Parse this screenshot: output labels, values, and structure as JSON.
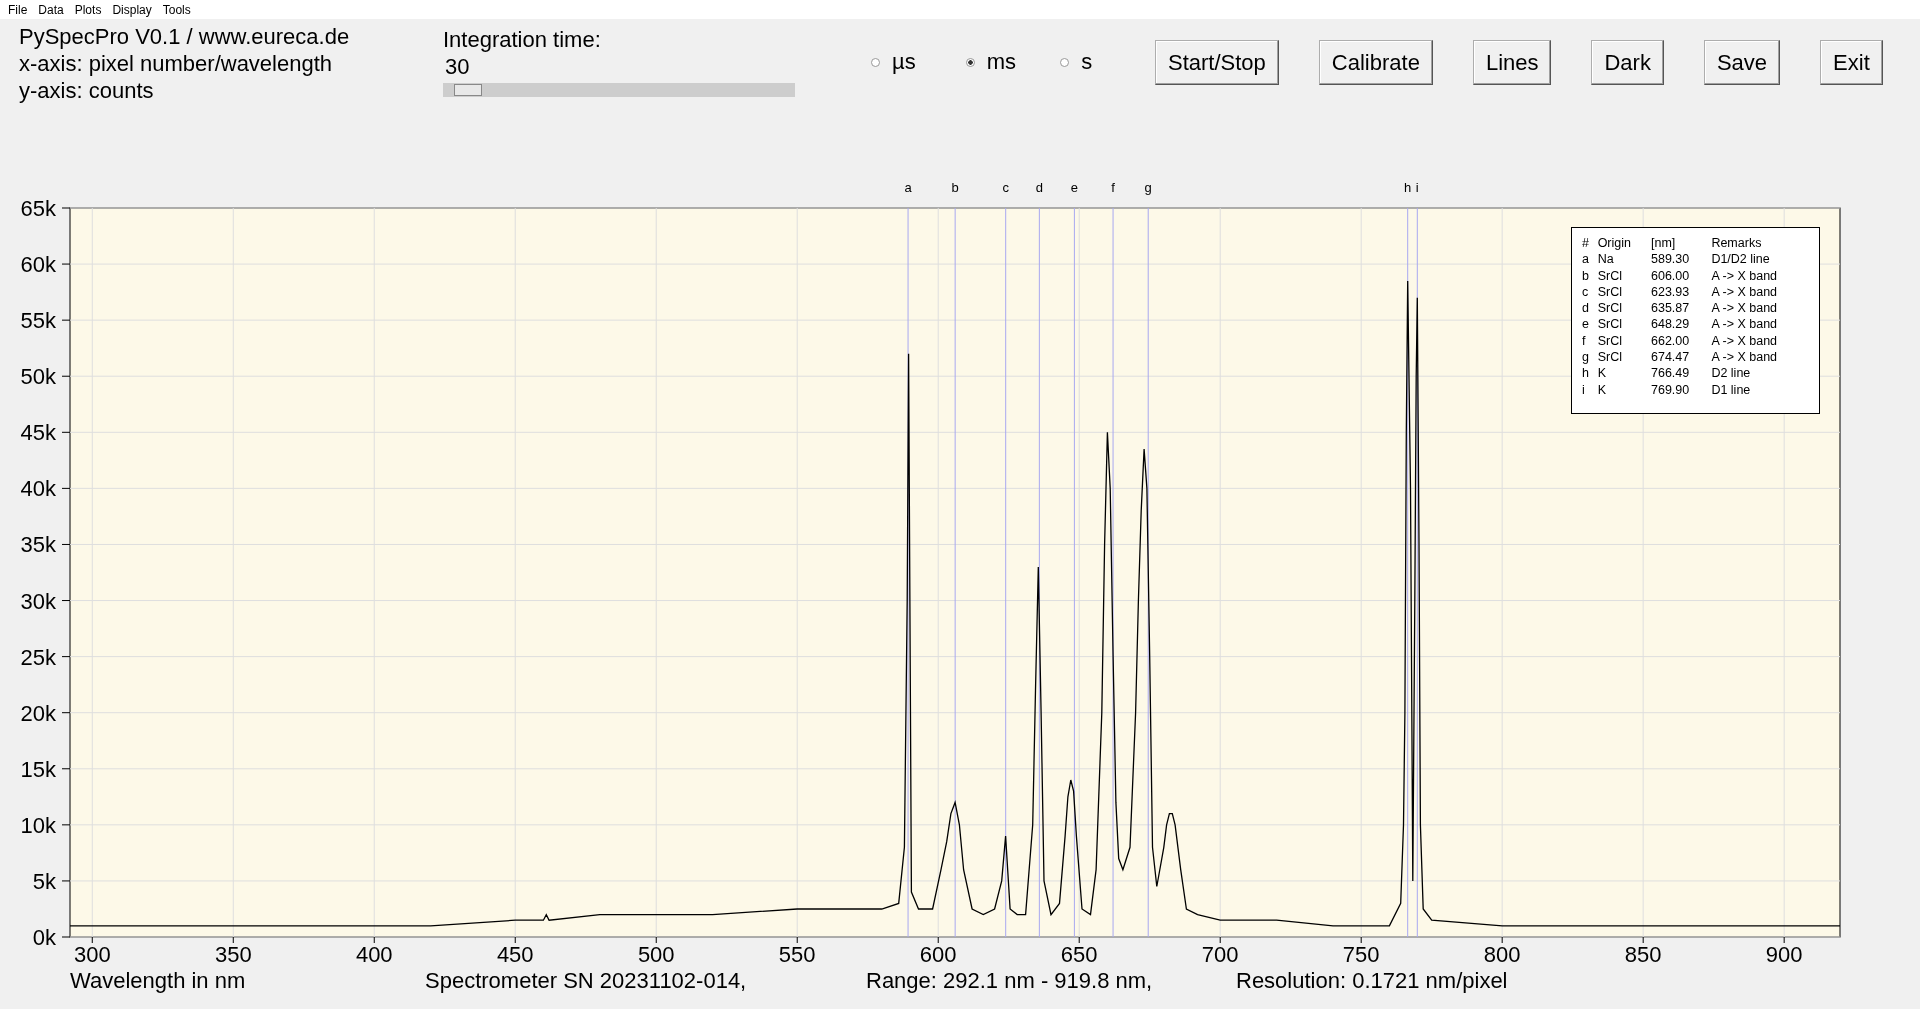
{
  "menu": [
    "File",
    "Data",
    "Plots",
    "Display",
    "Tools"
  ],
  "info": [
    "PySpecPro V0.1 / www.eureca.de",
    "x-axis: pixel number/wavelength",
    "y-axis: counts"
  ],
  "integration": {
    "label": "Integration time:",
    "value": "30",
    "level": 0.03
  },
  "units": [
    {
      "label": "µs",
      "selected": false
    },
    {
      "label": "ms",
      "selected": true
    },
    {
      "label": "s",
      "selected": false
    }
  ],
  "buttons": [
    "Start/Stop",
    "Calibrate",
    "Lines",
    "Dark",
    "Save",
    "Exit"
  ],
  "chart_data": {
    "type": "line",
    "xlabel": "Wavelength in nm",
    "xlim": [
      292.1,
      919.8
    ],
    "ylim": [
      0,
      65000
    ],
    "grid": true,
    "xticks": [
      300,
      350,
      400,
      450,
      500,
      550,
      600,
      650,
      700,
      750,
      800,
      850,
      900
    ],
    "yticks": [
      {
        "value": 0,
        "label": "0k"
      },
      {
        "value": 5000,
        "label": "5k"
      },
      {
        "value": 10000,
        "label": "10k"
      },
      {
        "value": 15000,
        "label": "15k"
      },
      {
        "value": 20000,
        "label": "20k"
      },
      {
        "value": 25000,
        "label": "25k"
      },
      {
        "value": 30000,
        "label": "30k"
      },
      {
        "value": 35000,
        "label": "35k"
      },
      {
        "value": 40000,
        "label": "40k"
      },
      {
        "value": 45000,
        "label": "45k"
      },
      {
        "value": 50000,
        "label": "50k"
      },
      {
        "value": 55000,
        "label": "55k"
      },
      {
        "value": 60000,
        "label": "60k"
      },
      {
        "value": 65000,
        "label": "65k"
      }
    ],
    "x": [
      292.1,
      320,
      350,
      380,
      420,
      450,
      460,
      461,
      462,
      480,
      500,
      520,
      550,
      570,
      580,
      586,
      588,
      589,
      589.5,
      590.5,
      593,
      598,
      601,
      603,
      604.5,
      606,
      607.5,
      609,
      612,
      616,
      620,
      622.5,
      623.9,
      625.5,
      628,
      631,
      633.5,
      634.5,
      635.5,
      636.5,
      637.5,
      640,
      643,
      645,
      646,
      647,
      648,
      649,
      651,
      654,
      656,
      658,
      659,
      660,
      661,
      662,
      663,
      664,
      665.5,
      668,
      670,
      671,
      672,
      673,
      674,
      675,
      676,
      677.5,
      680,
      681,
      682,
      683,
      684,
      686,
      688,
      692,
      700,
      720,
      740,
      760,
      764,
      765,
      765.5,
      766,
      766.5,
      767.5,
      768.3,
      769,
      769.5,
      769.9,
      770.5,
      771,
      772,
      775,
      800,
      850,
      900,
      919.8
    ],
    "series": [
      {
        "color": "#000000",
        "values": [
          1000,
          1000,
          1000,
          1000,
          1000,
          1500,
          1500,
          2000,
          1500,
          2000,
          2000,
          2000,
          2500,
          2500,
          2500,
          3000,
          8000,
          30000,
          52000,
          4000,
          2500,
          2500,
          6000,
          8500,
          11000,
          12000,
          10000,
          6000,
          2500,
          2000,
          2500,
          5000,
          9000,
          2500,
          2000,
          2000,
          10000,
          22000,
          33000,
          20000,
          5000,
          2000,
          3000,
          9000,
          12500,
          14000,
          13000,
          9000,
          2500,
          2000,
          6000,
          20000,
          35000,
          45000,
          40000,
          25000,
          12000,
          7000,
          6000,
          8000,
          20000,
          30000,
          38000,
          43500,
          40000,
          25000,
          8000,
          4500,
          8000,
          10000,
          11000,
          11000,
          10000,
          6000,
          2500,
          2000,
          1500,
          1500,
          1000,
          1000,
          3000,
          10000,
          20000,
          45000,
          58500,
          40000,
          5000,
          30000,
          50000,
          57000,
          35000,
          10000,
          2500,
          1500,
          1000,
          1000,
          1000,
          1000
        ]
      }
    ],
    "ref_lines": [
      {
        "axis": "x",
        "value": 589.3,
        "label": "a"
      },
      {
        "axis": "x",
        "value": 606.0,
        "label": "b"
      },
      {
        "axis": "x",
        "value": 623.93,
        "label": "c"
      },
      {
        "axis": "x",
        "value": 635.87,
        "label": "d"
      },
      {
        "axis": "x",
        "value": 648.29,
        "label": "e"
      },
      {
        "axis": "x",
        "value": 662.0,
        "label": "f"
      },
      {
        "axis": "x",
        "value": 674.47,
        "label": "g"
      },
      {
        "axis": "x",
        "value": 766.49,
        "label": "h"
      },
      {
        "axis": "x",
        "value": 769.9,
        "label": "i"
      }
    ]
  },
  "lines_table": {
    "columns": [
      "#",
      "Origin",
      "[nm]",
      "Remarks"
    ],
    "rows": [
      [
        "a",
        "Na",
        "589.30",
        "D1/D2 line"
      ],
      [
        "b",
        "SrCl",
        "606.00",
        "A -> X band"
      ],
      [
        "c",
        "SrCl",
        "623.93",
        "A -> X band"
      ],
      [
        "d",
        "SrCl",
        "635.87",
        "A -> X band"
      ],
      [
        "e",
        "SrCl",
        "648.29",
        "A -> X band"
      ],
      [
        "f",
        "SrCl",
        "662.00",
        "A -> X band"
      ],
      [
        "g",
        "SrCl",
        "674.47",
        "A -> X band"
      ],
      [
        "h",
        "K",
        "766.49",
        "D2 line"
      ],
      [
        "i",
        "K",
        "769.90",
        "D1 line"
      ]
    ]
  },
  "status_bar": [
    "Spectrometer SN 20231102-014,",
    "Range: 292.1 nm - 919.8 nm,",
    "Resolution: 0.1721 nm/pixel"
  ]
}
